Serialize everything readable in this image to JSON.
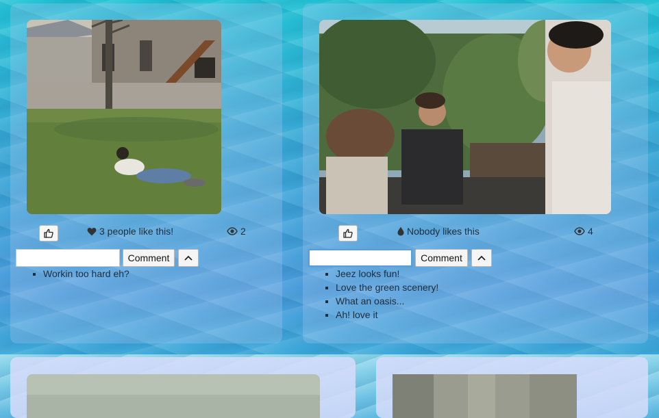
{
  "posts": [
    {
      "likes_text": "3 people like this!",
      "likes_icon": "heart-icon",
      "views": "2",
      "comment_button": "Comment",
      "comment_placeholder": "",
      "comments": [
        "Workin too hard eh?"
      ]
    },
    {
      "likes_text": "Nobody likes this",
      "likes_icon": "droplet-icon",
      "views": "4",
      "comment_button": "Comment",
      "comment_placeholder": "",
      "comments": [
        "Jeez looks fun!",
        "Love the green scenery!",
        "What an oasis...",
        "Ah! love it"
      ]
    }
  ],
  "colors": {
    "card_overlay": "#aac8f0",
    "focus_ring": "#5b9dd9",
    "text": "#1f2d3a"
  }
}
